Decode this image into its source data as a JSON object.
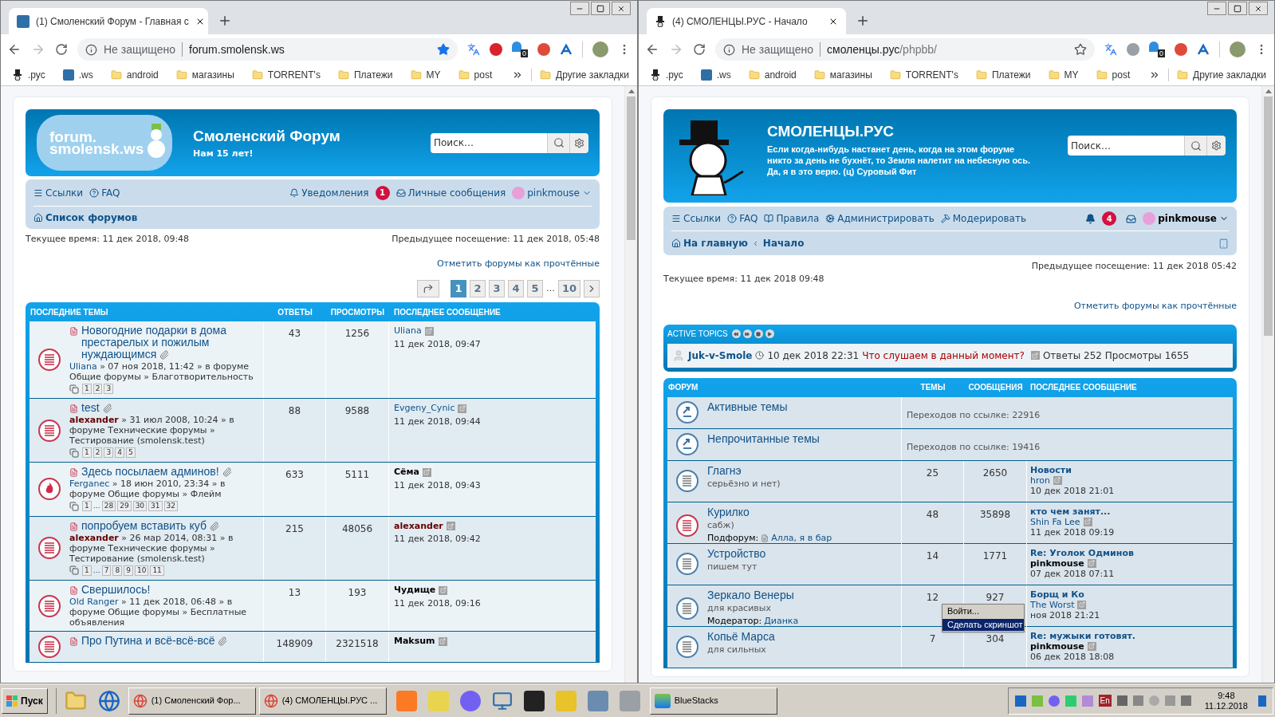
{
  "windows": [
    {
      "tab": {
        "title": "(1) Смоленский Форум - Главная с"
      },
      "omnibox": {
        "security": "Не защищено",
        "host": "forum.smolensk.ws",
        "bookmarked": true
      },
      "extensions": {
        "badge": "0",
        "adblock_active": true
      },
      "bookmarks": [
        {
          "kind": "hat",
          "label": ".рус"
        },
        {
          "kind": "ws",
          "label": ".ws"
        },
        {
          "kind": "folder",
          "label": "android"
        },
        {
          "kind": "folder",
          "label": "магазины"
        },
        {
          "kind": "folder",
          "label": "TORRENT's"
        },
        {
          "kind": "folder",
          "label": "Платежи"
        },
        {
          "kind": "folder",
          "label": "MY"
        },
        {
          "kind": "folder",
          "label": "post"
        }
      ],
      "other_bookmarks": "Другие закладки"
    },
    {
      "tab": {
        "title": "(4) СМОЛЕНЦЫ.РУС - Начало"
      },
      "omnibox": {
        "security": "Не защищено",
        "host": "смоленцы.рус",
        "path": "/phpbb/",
        "bookmarked": false
      },
      "extensions": {
        "badge": "0",
        "adblock_active": false
      },
      "bookmarks": [
        {
          "kind": "hat",
          "label": ".рус"
        },
        {
          "kind": "ws",
          "label": ".ws"
        },
        {
          "kind": "folder",
          "label": "android"
        },
        {
          "kind": "folder",
          "label": "магазины"
        },
        {
          "kind": "folder",
          "label": "TORRENT's"
        },
        {
          "kind": "folder",
          "label": "Платежи"
        },
        {
          "kind": "folder",
          "label": "MY"
        },
        {
          "kind": "folder",
          "label": "post"
        }
      ],
      "other_bookmarks": "Другие закладки"
    }
  ],
  "left_page": {
    "header": {
      "logo_lines": [
        "forum.",
        "smolensk.ws"
      ],
      "title": "Смоленский Форум",
      "subtitle": "Нам 15 лет!",
      "search_placeholder": "Поиск…"
    },
    "nav": {
      "links": [
        {
          "kind": "menu",
          "label": "Ссылки"
        },
        {
          "kind": "help",
          "label": "FAQ"
        }
      ],
      "notifications": {
        "label": "Уведомления",
        "count": "1"
      },
      "messages": {
        "label": "Личные сообщения"
      },
      "user": "pinkmouse",
      "breadcrumbs": [
        {
          "kind": "home",
          "label": "Список форумов"
        }
      ]
    },
    "current_time": "Текущее время: 11 дек 2018, 09:48",
    "last_visit": "Предыдущее посещение: 11 дек 2018, 05:48",
    "mark_read": "Отметить форумы как прочтённые",
    "pagination": [
      {
        "kind": "page",
        "label": "1",
        "selected": true
      },
      {
        "kind": "page",
        "label": "2",
        "selected": false
      },
      {
        "kind": "page",
        "label": "3",
        "selected": false
      },
      {
        "kind": "page",
        "label": "4",
        "selected": false
      },
      {
        "kind": "page",
        "label": "5",
        "selected": false
      },
      {
        "kind": "ellipsis",
        "label": "…",
        "selected": false
      },
      {
        "kind": "page",
        "label": "10",
        "selected": false
      }
    ],
    "topics": {
      "columns": [
        "ПОСЛЕДНИЕ ТЕМЫ",
        "ОТВЕТЫ",
        "ПРОСМОТРЫ",
        "ПОСЛЕДНЕЕ СООБЩЕНИЕ"
      ],
      "rows": [
        {
          "title": "Новогодние подарки в дома престарелых и пожилым нуждающимся",
          "attachment": true,
          "hot": false,
          "author": {
            "name": "Uliana",
            "color": "#105289",
            "bold": false
          },
          "meta": "» 07 ноя 2018, 11:42 » в форуме Общие форумы » Благотворительность",
          "pages": [
            "1",
            "2",
            "3"
          ],
          "replies": "43",
          "views": "1256",
          "last_author": {
            "name": "Uliana",
            "color": "#105289",
            "bold": false
          },
          "last_date": "11 дек 2018, 09:47"
        },
        {
          "title": "test",
          "attachment": true,
          "hot": false,
          "author": {
            "name": "alexander",
            "color": "#660000",
            "bold": true
          },
          "meta": "» 31 июл 2008, 10:24 » в форуме Технические форумы » Тестирование (smolensk.test)",
          "pages": [
            "1",
            "2",
            "3",
            "4",
            "5"
          ],
          "replies": "88",
          "views": "9588",
          "last_author": {
            "name": "Evgeny_Cynic",
            "color": "#105289",
            "bold": false
          },
          "last_date": "11 дек 2018, 09:44"
        },
        {
          "title": "Здесь посылаем админов!",
          "attachment": true,
          "hot": true,
          "author": {
            "name": "Ferganec",
            "color": "#105289",
            "bold": false
          },
          "meta": "» 18 июн 2010, 23:34 » в форуме Общие форумы » Флейм",
          "pages": [
            "1",
            "…",
            "28",
            "29",
            "30",
            "31",
            "32"
          ],
          "replies": "633",
          "views": "5111",
          "last_author": {
            "name": "Сёма",
            "color": "#000000",
            "bold": true
          },
          "last_date": "11 дек 2018, 09:43"
        },
        {
          "title": "попробуем вставить куб",
          "attachment": true,
          "hot": false,
          "author": {
            "name": "alexander",
            "color": "#660000",
            "bold": true
          },
          "meta": "» 26 мар 2014, 08:31 » в форуме Технические форумы » Тестирование (smolensk.test)",
          "pages": [
            "1",
            "…",
            "7",
            "8",
            "9",
            "10",
            "11"
          ],
          "replies": "215",
          "views": "48056",
          "last_author": {
            "name": "alexander",
            "color": "#660000",
            "bold": true
          },
          "last_date": "11 дек 2018, 09:42"
        },
        {
          "title": "Свершилось!",
          "attachment": false,
          "hot": false,
          "author": {
            "name": "Old Ranger",
            "color": "#105289",
            "bold": false
          },
          "meta": "» 11 дек 2018, 06:48 » в форуме Общие форумы » Бесплатные объявления",
          "replies": "13",
          "views": "193",
          "last_author": {
            "name": "Чудище",
            "color": "#000000",
            "bold": true
          },
          "last_date": "11 дек 2018, 09:16"
        },
        {
          "title": "Про Путина и всё-всё-всё",
          "attachment": true,
          "hot": false,
          "replies": "148909",
          "views": "2321518",
          "last_author": {
            "name": "Maksum",
            "color": "#000000",
            "bold": true
          }
        }
      ]
    }
  },
  "right_page": {
    "header": {
      "title": "СМОЛЕНЦЫ.РУС",
      "description": "Если когда-нибудь настанет день, когда на этом форуме никто за день не бухнёт, то Земля налетит на небесную ось. Да, я в это верю. (ц) Суровый Фит",
      "search_placeholder": "Поиск…"
    },
    "nav": {
      "links": [
        {
          "kind": "menu",
          "label": "Ссылки"
        },
        {
          "kind": "help",
          "label": "FAQ"
        },
        {
          "kind": "book",
          "label": "Правила"
        },
        {
          "kind": "cogs",
          "label": "Администрировать"
        },
        {
          "kind": "hammer",
          "label": "Модерировать"
        }
      ],
      "notifications": {
        "count": "4"
      },
      "user": "pinkmouse",
      "breadcrumbs": [
        {
          "kind": "home",
          "label": "На главную"
        },
        {
          "kind": "plain",
          "label": "Начало"
        }
      ]
    },
    "last_visit": "Предыдущее посещение: 11 дек 2018 05:42",
    "current_time": "Текущее время: 11 дек 2018 09:48",
    "mark_read": "Отметить форумы как прочтённые",
    "active_topics": {
      "title": "ACTIVE TOPICS",
      "topic": {
        "author": "Juk-v-Smole",
        "time": "10 дек 2018 22:31",
        "title": "Что слушаем в данный момент?",
        "stats": "Ответы 252 Просмотры 1655"
      }
    },
    "forums": {
      "columns": [
        "ФОРУМ",
        "ТЕМЫ",
        "СООБЩЕНИЯ",
        "ПОСЛЕДНЕЕ СООБЩЕНИЕ"
      ],
      "rows": [
        {
          "kind": "link",
          "name": "Активные темы",
          "redirects": "Переходов по ссылке: 22916"
        },
        {
          "kind": "link",
          "name": "Непрочитанные темы",
          "redirects": "Переходов по ссылке: 19416"
        },
        {
          "kind": "forum",
          "unread": false,
          "name": "Глагнэ",
          "description": "серьёзно и нет)",
          "topics": "25",
          "posts": "2650",
          "last": {
            "title": "Новости",
            "author": "hron",
            "author_bold": false,
            "date": "10 дек 2018 21:01"
          }
        },
        {
          "kind": "forum",
          "unread": true,
          "name": "Курилко",
          "description": "сабж)",
          "extra": {
            "kind": "subforum",
            "label": "Подфорум:",
            "name": "Алла, я в бар"
          },
          "topics": "48",
          "posts": "35898",
          "last": {
            "title": "кто чем занят...",
            "author": "Shin Fa Lee",
            "author_bold": false,
            "date": "11 дек 2018 09:19"
          }
        },
        {
          "kind": "forum",
          "unread": false,
          "name": "Устройство",
          "description": "пишем тут",
          "topics": "14",
          "posts": "1771",
          "last": {
            "title": "Re: Уголок Одминов",
            "author": "pinkmouse",
            "author_bold": true,
            "date": "07 дек 2018 07:11"
          }
        },
        {
          "kind": "forum",
          "unread": false,
          "name": "Зеркало Венеры",
          "description": "для красивых",
          "extra": {
            "kind": "moderator",
            "label": "Модератор:",
            "name": "Дианка"
          },
          "topics": "12",
          "posts": "927",
          "last": {
            "title": "Борщ и Ко",
            "author": "The Worst",
            "author_bold": false,
            "date": "ноя 2018 21:21"
          }
        },
        {
          "kind": "forum",
          "unread": false,
          "name": "Копьё Марса",
          "description": "для сильных",
          "topics": "7",
          "posts": "304",
          "last": {
            "title": "Re: мужыки готовят.",
            "author": "pinkmouse",
            "author_bold": true,
            "date": "06 дек 2018 18:08"
          }
        }
      ]
    }
  },
  "context_menu": {
    "items": [
      {
        "label": "Войти...",
        "selected": false
      },
      {
        "label": "Сделать скриншот",
        "selected": true
      }
    ]
  },
  "taskbar": {
    "start": "Пуск",
    "tasks": [
      {
        "kind": "chrome",
        "label": "(1) Смоленский Фор..."
      },
      {
        "kind": "chrome",
        "label": "(4) СМОЛЕНЦЫ.РУС ..."
      },
      {
        "kind": "bluestacks",
        "label": "BlueStacks"
      }
    ],
    "language": "En",
    "time": "9:48",
    "date": "11.12.2018"
  }
}
